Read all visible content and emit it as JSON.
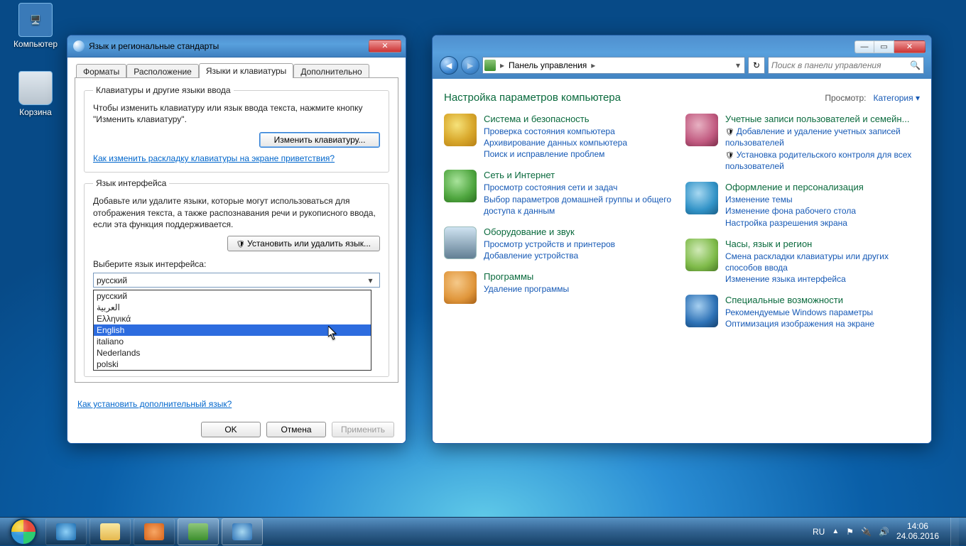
{
  "desktop": {
    "icons": {
      "computer": "Компьютер",
      "recycle": "Корзина"
    }
  },
  "dialog": {
    "title": "Язык и региональные стандарты",
    "tabs": [
      "Форматы",
      "Расположение",
      "Языки и клавиатуры",
      "Дополнительно"
    ],
    "group1_legend": "Клавиатуры и другие языки ввода",
    "group1_text": "Чтобы изменить клавиатуру или язык ввода текста, нажмите кнопку \"Изменить клавиатуру\".",
    "change_kb_btn": "Изменить клавиатуру...",
    "welcome_link": "Как изменить раскладку клавиатуры на экране приветствия?",
    "group2_legend": "Язык интерфейса",
    "group2_text": "Добавьте или удалите языки, которые могут использоваться для отображения текста, а также распознавания речи и рукописного ввода, если эта функция поддерживается.",
    "install_lang_btn": "Установить или удалить язык...",
    "select_label": "Выберите язык интерфейса:",
    "select_value": "русский",
    "options": [
      "русский",
      "العربية",
      "Ελληνικά",
      "English",
      "italiano",
      "Nederlands",
      "polski"
    ],
    "addl_link": "Как установить дополнительный язык?",
    "ok": "OK",
    "cancel": "Отмена",
    "apply": "Применить"
  },
  "cp": {
    "breadcrumb": "Панель управления",
    "search_placeholder": "Поиск в панели управления",
    "heading": "Настройка параметров компьютера",
    "view_label": "Просмотр:",
    "view_value": "Категория",
    "cats": [
      {
        "title": "Система и безопасность",
        "links": [
          "Проверка состояния компьютера",
          "Архивирование данных компьютера",
          "Поиск и исправление проблем"
        ]
      },
      {
        "title": "Сеть и Интернет",
        "links": [
          "Просмотр состояния сети и задач",
          "Выбор параметров домашней группы и общего доступа к данным"
        ]
      },
      {
        "title": "Оборудование и звук",
        "links": [
          "Просмотр устройств и принтеров",
          "Добавление устройства"
        ]
      },
      {
        "title": "Программы",
        "links": [
          "Удаление программы"
        ]
      },
      {
        "title": "Учетные записи пользователей и семейн...",
        "links": [
          "Добавление и удаление учетных записей пользователей",
          "Установка родительского контроля для всех пользователей"
        ],
        "shield": [
          0,
          1
        ]
      },
      {
        "title": "Оформление и персонализация",
        "links": [
          "Изменение темы",
          "Изменение фона рабочего стола",
          "Настройка разрешения экрана"
        ]
      },
      {
        "title": "Часы, язык и регион",
        "links": [
          "Смена раскладки клавиатуры или других способов ввода",
          "Изменение языка интерфейса"
        ]
      },
      {
        "title": "Специальные возможности",
        "links": [
          "Рекомендуемые Windows параметры",
          "Оптимизация изображения на экране"
        ]
      }
    ]
  },
  "taskbar": {
    "lang": "RU",
    "time": "14:06",
    "date": "24.06.2016"
  }
}
